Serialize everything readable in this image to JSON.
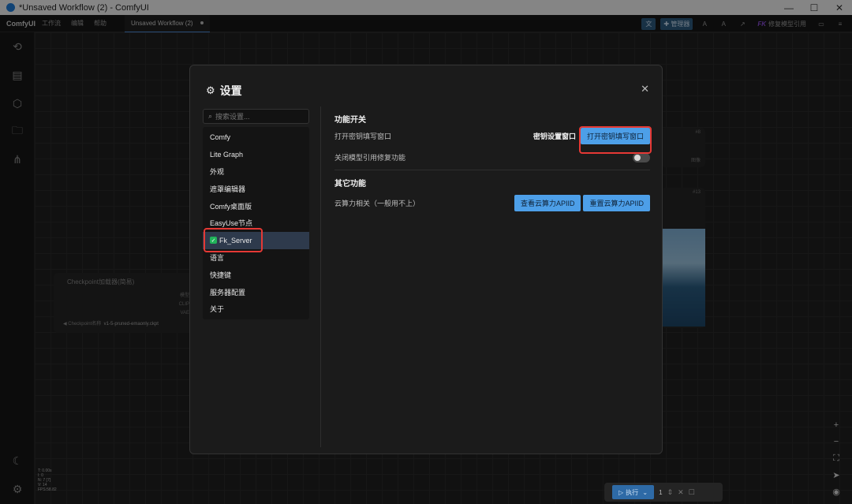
{
  "window": {
    "title": "*Unsaved Workflow (2) - ComfyUI",
    "controls": [
      "—",
      "☐",
      "✕"
    ]
  },
  "menubar": {
    "logo": "ComfyUI",
    "items": [
      "工作流",
      "编辑",
      "帮助"
    ],
    "tab": "Unsaved Workflow (2)",
    "tools": {
      "translate": "文",
      "manager": "管理器",
      "a1": "A",
      "a2": "A",
      "share": "↗",
      "fk_mark": "FK",
      "repair": "修复模型引用",
      "panel": "▭",
      "menu": "≡"
    }
  },
  "canvas_nodes": {
    "checkpoint_title": "Checkpoint加载器(简易)",
    "ckpt_label": "Checkpoint名称",
    "ckpt_value": "v1-5-pruned-emaonly.ckpt",
    "out1": "模型",
    "out2": "CLIP",
    "out3": "VAE",
    "node8": "#8",
    "node8_out": "图像",
    "node13": "#13"
  },
  "dialog": {
    "title": "设置",
    "close": "✕",
    "search_placeholder": "搜索设置...",
    "nav": [
      {
        "label": "Comfy"
      },
      {
        "label": "Lite Graph"
      },
      {
        "label": "外观"
      },
      {
        "label": "遮罩编辑器"
      },
      {
        "label": "Comfy桌面版"
      },
      {
        "label": "EasyUse节点"
      },
      {
        "label": "Fk_Server",
        "active": true
      },
      {
        "label": "语言"
      },
      {
        "label": "快捷键"
      },
      {
        "label": "服务器配置"
      },
      {
        "label": "关于"
      }
    ],
    "section1": {
      "title": "功能开关",
      "row1_label": "打开密钥填写窗口",
      "row1_key_label": "密钥设置窗口",
      "row1_button": "打开密钥填写窗口",
      "row2_label": "关闭模型引用修复功能",
      "row2_toggle": false
    },
    "section2": {
      "title": "其它功能",
      "row1_label": "云算力相关（一般用不上）",
      "btn_view": "查看云算力APIID",
      "btn_reset": "重置云算力APIID"
    }
  },
  "runbar": {
    "run_label": "执行",
    "count": "1"
  },
  "stats": [
    "T: 0.00s",
    "I: 0",
    "N: 7 [7]",
    "V: 14",
    "FPS:58.82"
  ],
  "colors": {
    "accent": "#4d9fe8",
    "highlight": "#e53935",
    "active_nav": "#2e3a4c",
    "check": "#21b35a"
  }
}
